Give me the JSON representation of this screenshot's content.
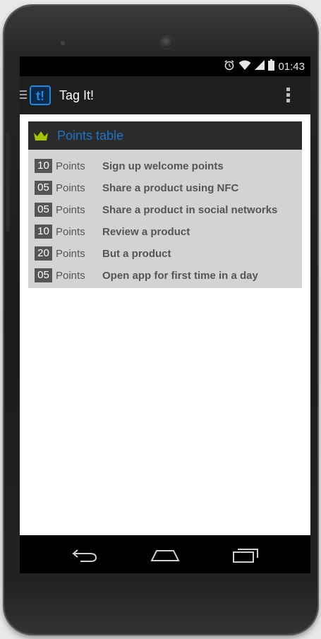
{
  "statusbar": {
    "time": "01:43",
    "icons": [
      "alarm-icon",
      "wifi-icon",
      "signal-icon",
      "battery-icon"
    ]
  },
  "actionbar": {
    "logo_text": "t!",
    "title": "Tag It!"
  },
  "points_table": {
    "title": "Points table",
    "rows": [
      {
        "points": "10",
        "unit": "Points",
        "description": "Sign up welcome points"
      },
      {
        "points": "05",
        "unit": "Points",
        "description": "Share a product using NFC"
      },
      {
        "points": "05",
        "unit": "Points",
        "description": "Share a product in social networks"
      },
      {
        "points": "10",
        "unit": "Points",
        "description": "Review a product"
      },
      {
        "points": "20",
        "unit": "Points",
        "description": "But a product"
      },
      {
        "points": "05",
        "unit": "Points",
        "description": "Open app for first time in a day"
      }
    ]
  },
  "colors": {
    "accent": "#1e73c8",
    "crown": "#a4c400",
    "card_bg": "#d3d3d3",
    "badge_bg": "#555555"
  },
  "navbar": {
    "icons": [
      "back-icon",
      "home-icon",
      "recents-icon"
    ]
  }
}
